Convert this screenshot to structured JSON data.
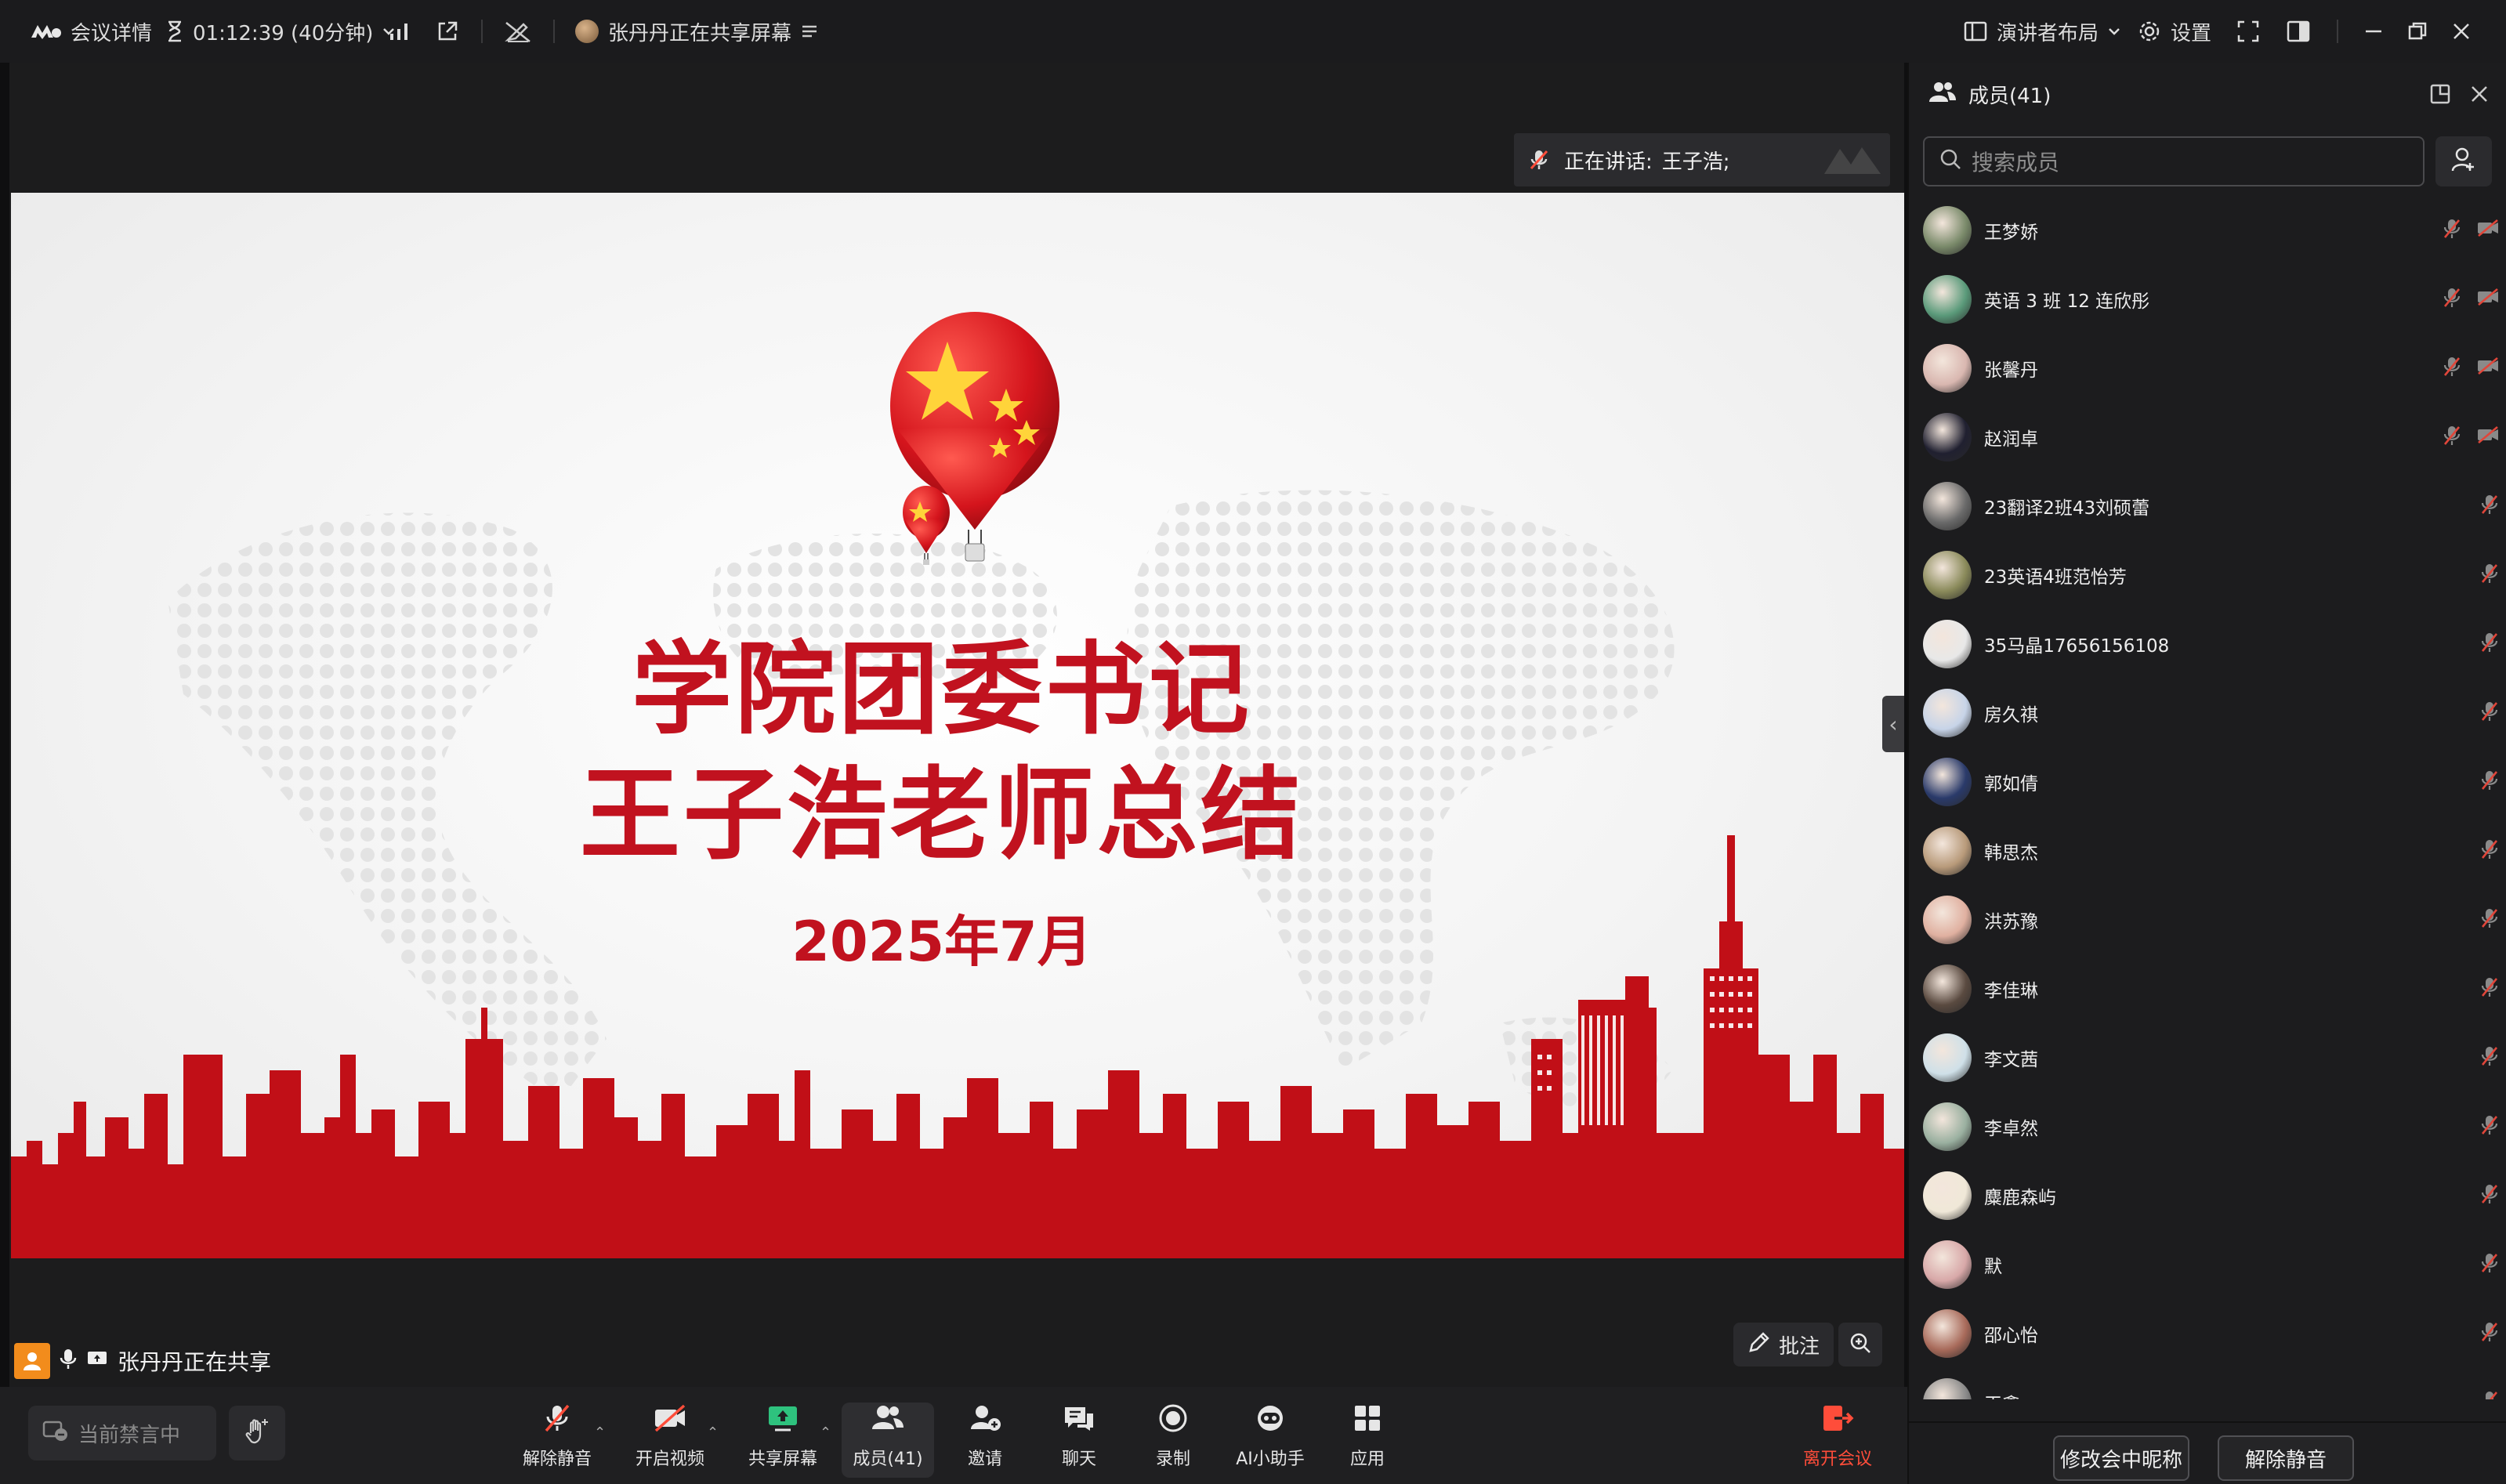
{
  "topbar": {
    "meeting_details": "会议详情",
    "timer": "01:12:39 (40分钟)",
    "sharing_status": "张丹丹正在共享屏幕",
    "layout": "演讲者布局",
    "settings": "设置"
  },
  "speaker": {
    "label": "正在讲话:",
    "name": "王子浩;"
  },
  "slide": {
    "title_line1": "学院团委书记",
    "title_line2": "王子浩老师总结",
    "date": "2025年7月"
  },
  "share_indicator": {
    "text": "张丹丹正在共享"
  },
  "annotate": {
    "label": "批注"
  },
  "toolbar": {
    "mute_all": "当前禁言中",
    "unmute": "解除静音",
    "video": "开启视频",
    "share": "共享屏幕",
    "members": "成员(41)",
    "invite": "邀请",
    "chat": "聊天",
    "record": "录制",
    "ai": "AI小助手",
    "apps": "应用",
    "leave": "离开会议"
  },
  "panel": {
    "title": "成员(41)",
    "search_placeholder": "搜索成员",
    "members": [
      {
        "name": "王梦娇",
        "avatar_color": "#7a8a6a",
        "video_off": true
      },
      {
        "name": "英语 3 班 12 连欣彤",
        "avatar_color": "#5a9a7a",
        "video_off": true
      },
      {
        "name": "张馨丹",
        "avatar_color": "#d9b7b0",
        "video_off": true
      },
      {
        "name": "赵润卓",
        "avatar_color": "#202030",
        "video_off": true
      },
      {
        "name": "23翻译2班43刘硕蕾",
        "avatar_color": "#6a6a6a",
        "video_off": false
      },
      {
        "name": "23英语4班范怡芳",
        "avatar_color": "#8a8a5a",
        "video_off": false
      },
      {
        "name": "35马晶17656156108",
        "avatar_color": "#e8e8e8",
        "video_off": false
      },
      {
        "name": "房久祺",
        "avatar_color": "#c7d4e8",
        "video_off": false
      },
      {
        "name": "郭如倩",
        "avatar_color": "#2a3a6a",
        "video_off": false
      },
      {
        "name": "韩思杰",
        "avatar_color": "#b89a7a",
        "video_off": false
      },
      {
        "name": "洪苏豫",
        "avatar_color": "#e0b0a0",
        "video_off": false
      },
      {
        "name": "李佳琳",
        "avatar_color": "#5a4a40",
        "video_off": false
      },
      {
        "name": "李文茜",
        "avatar_color": "#cfe0e8",
        "video_off": false
      },
      {
        "name": "李卓然",
        "avatar_color": "#9ab0a0",
        "video_off": false
      },
      {
        "name": "麋鹿森屿",
        "avatar_color": "#f0e8d8",
        "video_off": false
      },
      {
        "name": "默",
        "avatar_color": "#d8a8a8",
        "video_off": false
      },
      {
        "name": "邵心怡",
        "avatar_color": "#a86a5a",
        "video_off": false
      },
      {
        "name": "王鑫",
        "avatar_color": "#8a8a8a",
        "video_off": false
      }
    ],
    "rename_button": "修改会中昵称",
    "unmute_button": "解除静音"
  },
  "colors": {
    "accent_red": "#c1121f",
    "muted_red": "#e0463a",
    "bg": "#1c1c1e"
  }
}
